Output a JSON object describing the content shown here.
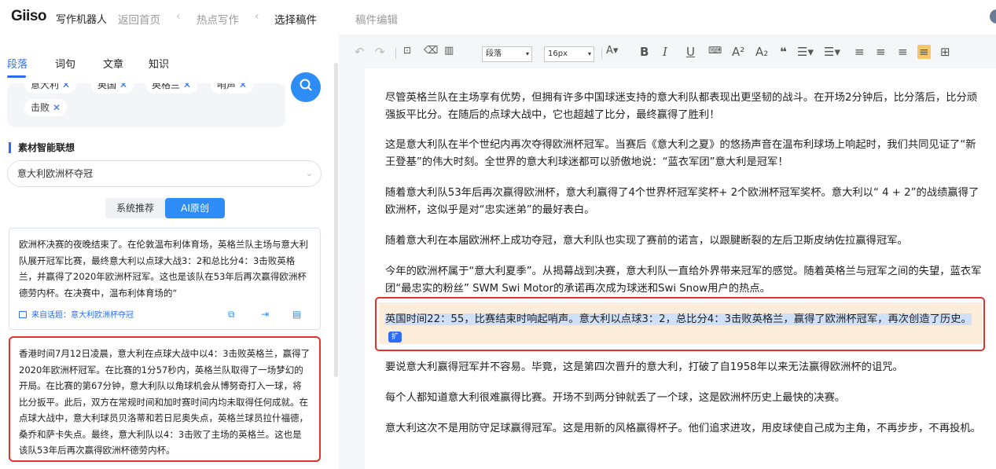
{
  "header": {
    "logo": "Giiso",
    "logo_sub": "写作机器人",
    "breadcrumbs": [
      "返回首页",
      "热点写作",
      "选择稿件",
      "稿件编辑"
    ]
  },
  "left": {
    "tabs": [
      "段落",
      "词句",
      "文章",
      "知识"
    ],
    "active_tab": "段落",
    "tags": [
      "意大利",
      "英国",
      "英格兰",
      "哨声",
      "击败"
    ],
    "section_title": "素材智能联想",
    "select_value": "意大利欧洲杯夺冠",
    "segments": [
      "系统推荐",
      "AI原创"
    ],
    "active_segment": "AI原创",
    "card1": {
      "text": "欧洲杯决赛的夜晚结束了。在伦敦温布利体育场，英格兰队主场与意大利队展开冠军比赛，最终意大利以点球大战3：2和总比分4：3击败英格兰，并赢得了2020年欧洲杯冠军。这也是该队在53年后再次赢得欧洲杯德劳内杯。在决赛中，温布利体育场的“",
      "source": "来自话题：意大利欧洲杯夺冠"
    },
    "card2": {
      "text": "香港时间7月12日凌晨，意大利在点球大战中以4：3击败英格兰，赢得了2020年欧洲杯冠军。在比赛的1分57秒内，英格兰队取得了一场梦幻的开局。在比赛的第67分钟，意大利队以角球机会从博努奇打入一球，将比分扳平。此后，双方在常规时间和加时赛时间内均未取得任何成就。在点球大战中，意大利球员贝洛蒂和若日尼奥失点，英格兰球员拉什福德，桑乔和萨卡失点。最终，意大利队以4：3击败了主场的英格兰。这也是该队53年后再次赢得欧洲杯德劳内杯。"
    }
  },
  "toolbar": {
    "paragraph_select": "段落",
    "size_select": "16px"
  },
  "editor": {
    "paragraphs": [
      "尽管英格兰队在主场享有优势，但拥有许多中国球迷支持的意大利队都表现出更坚韧的战斗。在开场2分钟后，比分落后，比分顽强扳平比分。在随后的点球大战中，它也超越了比分，最终赢得了胜利！",
      "这是意大利队在半个世纪内再次夺得欧洲杯冠军。当赛后《意大利之夏》的悠扬声音在温布利球场上响起时，我们共同见证了“新王登基”的伟大时刻。全世界的意大利球迷都可以骄傲地说：“蓝衣军团”意大利是冠军！",
      "随着意大利队53年后再次赢得欧洲杯，意大利赢得了4个世界杯冠军奖杯+ 2个欧洲杯冠军奖杯。意大利以“ 4 + 2”的战绩赢得了欧洲杯，这似乎是对“忠实迷弟”的最好表白。",
      "随着意大利在本届欧洲杯上成功夺冠，意大利队也实现了赛前的诺言，以跟腱断裂的左后卫斯皮纳佐拉赢得冠军。",
      "今年的欧洲杯属于“意大利夏季”。从揭幕战到决赛，意大利队一直给外界带来冠军的感觉。随着英格兰与冠军之间的失望，蓝衣军团“最忠实的粉丝” SWM Swi Motor的承诺再次成为球迷和Swi Snow用户的热点。",
      "英国时间22：55，比赛结束时响起哨声。意大利以点球3：2，总比分4：3击败英格兰，赢得了欧洲杯冠军，再次创造了历史。",
      "要说意大利赢得冠军并不容易。毕竟，这是第四次晋升的意大利，打破了自1958年以来无法赢得欧洲杯的诅咒。",
      "每个人都知道意大利很难赢得比赛。开场不到两分钟就丢了一个球，这是欧洲杯历史上最快的决赛。",
      "意大利这次不是用防守足球赢得冠军。这是用新的风格赢得杯子。他们追求进攻，用皮球使自己成为主角，不再步步，不再投机。"
    ],
    "expand_label": "扩"
  }
}
